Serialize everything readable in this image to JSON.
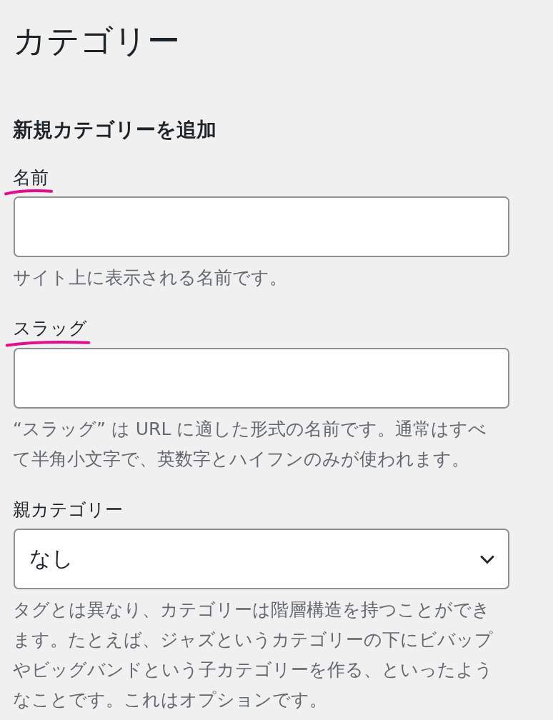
{
  "page_title": "カテゴリー",
  "section_title": "新規カテゴリーを追加",
  "fields": [
    {
      "kind": "text",
      "label": "名前",
      "underlined": true,
      "help": "サイト上に表示される名前です。"
    },
    {
      "kind": "text",
      "label": "スラッグ",
      "underlined": true,
      "help": "“スラッグ” は URL に適した形式の名前です。通常はすべて半角小文字で、英数字とハイフンのみが使われます。"
    },
    {
      "kind": "select",
      "label": "親カテゴリー",
      "underlined": false,
      "value": "なし",
      "help": "タグとは異なり、カテゴリーは階層構造を持つことができます。たとえば、ジャズというカテゴリーの下にビバップやビッグバンドという子カテゴリーを作る、といったようなことです。これはオプションです。"
    }
  ]
}
